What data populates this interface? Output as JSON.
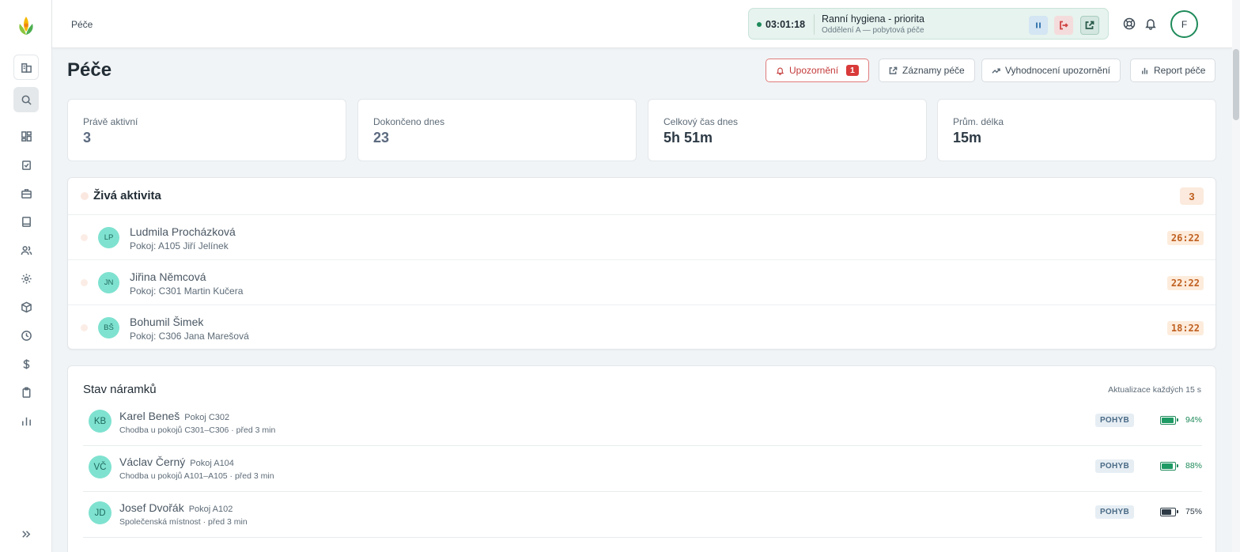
{
  "header": {
    "breadcrumb": "Péče",
    "timer": {
      "time": "03:01:18",
      "title": "Ranní hygiena - priorita",
      "subtitle": "Oddělení A — pobytová péče"
    },
    "user_initial": "F"
  },
  "page": {
    "title": "Péče",
    "buttons": {
      "alerts": "Upozornění",
      "alerts_count": "1",
      "care_records": "Záznamy péče",
      "alerts_eval": "Vyhodnocení upozornění",
      "care_report": "Report péče"
    }
  },
  "stats": [
    {
      "label": "Právě aktivní",
      "value": "3"
    },
    {
      "label": "Dokončeno dnes",
      "value": "23"
    },
    {
      "label": "Celkový čas dnes",
      "value": "5h 51m"
    },
    {
      "label": "Prům. délka",
      "value": "15m"
    }
  ],
  "live": {
    "title": "Živá aktivita",
    "count": "3",
    "rows": [
      {
        "initials": "LP",
        "name": "Ludmila Procházková",
        "sub": "Pokoj: A105  Jiří Jelínek",
        "time": "26:22"
      },
      {
        "initials": "JN",
        "name": "Jiřina Němcová",
        "sub": "Pokoj: C301  Martin Kučera",
        "time": "22:22"
      },
      {
        "initials": "BŠ",
        "name": "Bohumil Šimek",
        "sub": "Pokoj: C306  Jana Marešová",
        "time": "18:22"
      }
    ]
  },
  "bracelets": {
    "title": "Stav náramků",
    "note": "Aktualizace každých 15 s",
    "rows": [
      {
        "initials": "KB",
        "name": "Karel Beneš",
        "room": "Pokoj C302",
        "sub": "Chodba u pokojů C301–C306 · před 3 min",
        "status": "POHYB",
        "battery": "94%",
        "battery_level": 0.94
      },
      {
        "initials": "VČ",
        "name": "Václav Černý",
        "room": "Pokoj A104",
        "sub": "Chodba u pokojů A101–A105 · před 3 min",
        "status": "POHYB",
        "battery": "88%",
        "battery_level": 0.88
      },
      {
        "initials": "JD",
        "name": "Josef Dvořák",
        "room": "Pokoj A102",
        "sub": "Společenská místnost · před 3 min",
        "status": "POHYB",
        "battery": "75%",
        "battery_level": 0.75
      }
    ]
  },
  "colors": {
    "accent_green": "#1e8a5a",
    "alert_red": "#d93a3a",
    "avatar_teal": "#7fe2d0",
    "timer_orange": "#c06020"
  },
  "icons": {
    "sidebar": [
      "building-icon",
      "search-icon",
      "dashboard-icon",
      "clipboard-check-icon",
      "briefcase-icon",
      "book-icon",
      "users-icon",
      "gear-icon",
      "package-icon",
      "clock-icon",
      "dollar-icon",
      "clipboard-icon",
      "bar-chart-icon",
      "expand-icon"
    ]
  }
}
